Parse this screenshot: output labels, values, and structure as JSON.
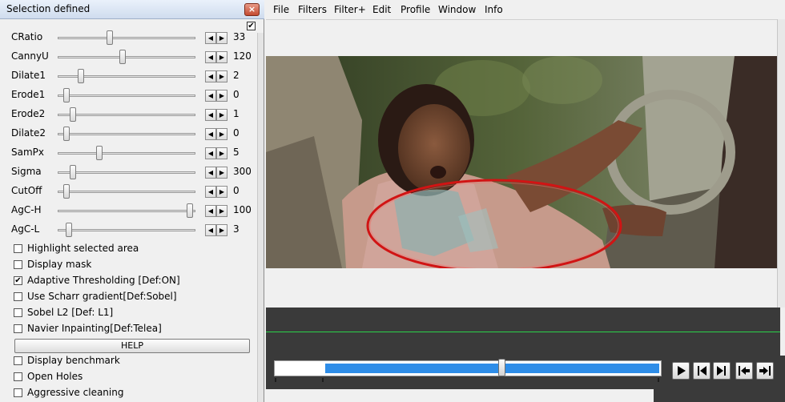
{
  "dialog": {
    "title": "Selection defined",
    "close_label": "×",
    "top_checkbox_checked": true,
    "sliders": [
      {
        "label": "CRatio",
        "value": "33",
        "position": 0.37
      },
      {
        "label": "CannyU",
        "value": "120",
        "position": 0.47
      },
      {
        "label": "Dilate1",
        "value": "2",
        "position": 0.15
      },
      {
        "label": "Erode1",
        "value": "0",
        "position": 0.04
      },
      {
        "label": "Erode2",
        "value": "1",
        "position": 0.09
      },
      {
        "label": "Dilate2",
        "value": "0",
        "position": 0.04
      },
      {
        "label": "SamPx",
        "value": "5",
        "position": 0.29
      },
      {
        "label": "Sigma",
        "value": "300",
        "position": 0.09
      },
      {
        "label": "CutOff",
        "value": "0",
        "position": 0.04
      },
      {
        "label": "AgC-H",
        "value": "100",
        "position": 0.98
      },
      {
        "label": "AgC-L",
        "value": "3",
        "position": 0.06
      }
    ],
    "checkboxes_top": [
      {
        "label": "Highlight selected area",
        "checked": false
      },
      {
        "label": "Display mask",
        "checked": false
      },
      {
        "label": "Adaptive Thresholding [Def:ON]",
        "checked": true
      },
      {
        "label": "Use Scharr gradient[Def:Sobel]",
        "checked": false
      },
      {
        "label": "Sobel L2 [Def: L1]",
        "checked": false
      },
      {
        "label": "Navier Inpainting[Def:Telea]",
        "checked": false
      }
    ],
    "help_label": "HELP",
    "checkboxes_bottom": [
      {
        "label": "Display benchmark",
        "checked": false
      },
      {
        "label": "Open Holes",
        "checked": false
      },
      {
        "label": "Aggressive cleaning",
        "checked": false
      }
    ]
  },
  "menu": [
    "File",
    "Filters",
    "Filter+",
    "Edit",
    "Profile",
    "Window",
    "Info"
  ],
  "seek": {
    "selection_start": 0.13,
    "selection_end": 0.995,
    "position": 0.58
  },
  "colors": {
    "selection_blue": "#2e8de8",
    "timeline_dark": "#3a3a3a",
    "marker_green": "#2ad24a",
    "annotation_red": "#d11414"
  },
  "icons": {
    "play": "play-icon",
    "prev_frame": "prev-frame-icon",
    "next_frame": "next-frame-icon",
    "go_start": "go-start-icon",
    "go_end": "go-end-icon"
  }
}
